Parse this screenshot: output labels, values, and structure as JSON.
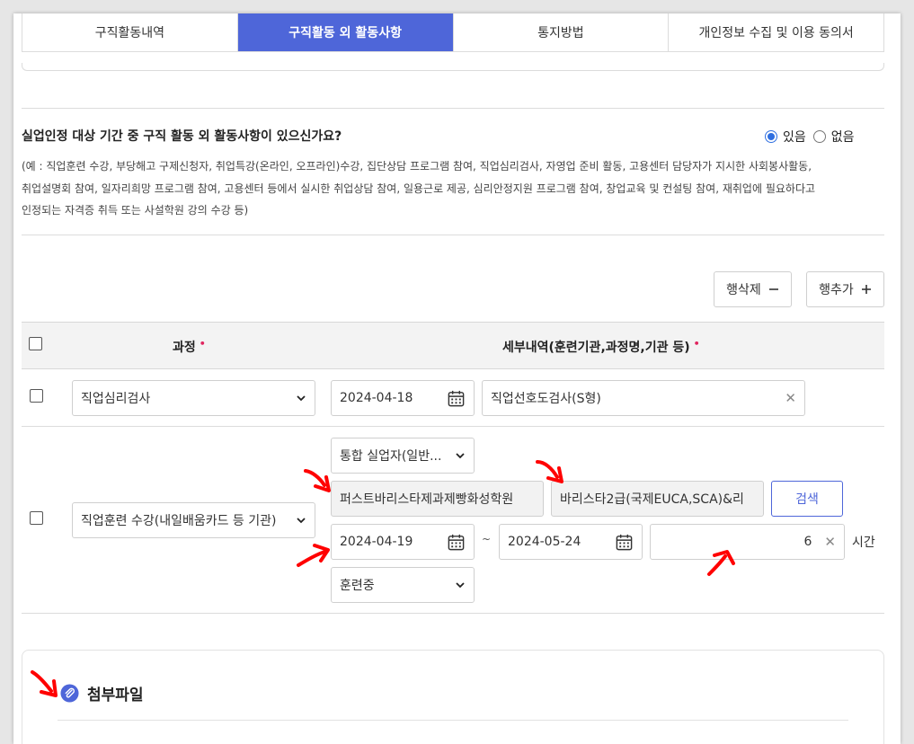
{
  "tabs": [
    {
      "label": "구직활동내역",
      "active": false
    },
    {
      "label": "구직활동 외 활동사항",
      "active": true
    },
    {
      "label": "통지방법",
      "active": false
    },
    {
      "label": "개인정보 수집 및 이용 동의서",
      "active": false
    }
  ],
  "question": {
    "text": "실업인정 대상 기간 중 구직 활동 외 활동사항이 있으신가요?",
    "options": [
      "있음",
      "없음"
    ],
    "selected": "있음"
  },
  "note": {
    "lines": [
      "(예 : 직업훈련 수강, 부당해고 구제신청자, 취업특강(온라인, 오프라인)수강, 집단상담 프로그램 참여, 직업심리검사, 자영업 준비 활동, 고용센터 담당자가 지시한 사회봉사활동,",
      "취업설명회 참여, 일자리희망 프로그램 참여, 고용센터 등에서 실시한 취업상담 참여, 일용근로 제공, 심리안정지원 프로그램 참여, 창업교육 및 컨설팅 참여, 재취업에 필요하다고",
      "인정되는 자격증 취득 또는 사설학원 강의 수강 등)"
    ]
  },
  "buttons": {
    "delete_row": "행삭제",
    "add_row": "행추가",
    "search": "검색"
  },
  "table": {
    "col_course": "과정",
    "col_detail": "세부내역(훈련기관,과정명,기관 등)",
    "required_mark": "•",
    "row1": {
      "course": "직업심리검사",
      "date": "2024-04-18",
      "detail": "직업선호도검사(S형)"
    },
    "row2": {
      "course": "직업훈련 수강(내일배움카드 등 기관)",
      "type": "통합 실업자(일반...",
      "institution": "퍼스트바리스타제과제빵화성학원",
      "program": "바리스타2급(국제EUCA,SCA)&리",
      "start_date": "2024-04-19",
      "tilde": "~",
      "end_date": "2024-05-24",
      "hours": "6",
      "hours_unit": "시간",
      "status": "훈련중"
    }
  },
  "attachment": {
    "title": "첨부파일"
  },
  "colors": {
    "accent": "#4e66d9",
    "radio": "#2f6fe0",
    "required": "#e0245e",
    "annotation_arrow": "#ff0000"
  }
}
